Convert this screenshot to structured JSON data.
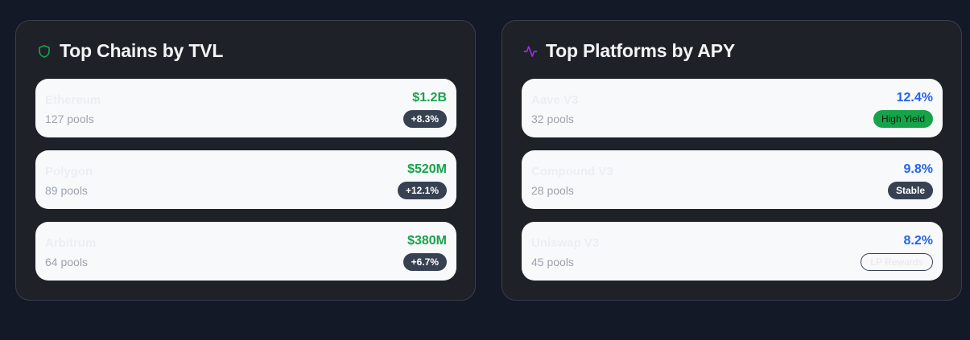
{
  "chains_panel": {
    "title": "Top Chains by TVL",
    "icon": "shield-icon",
    "rows": [
      {
        "name": "Ethereum",
        "pools": "127 pools",
        "value": "$1.2B",
        "change": "+8.3%"
      },
      {
        "name": "Polygon",
        "pools": "89 pools",
        "value": "$520M",
        "change": "+12.1%"
      },
      {
        "name": "Arbitrum",
        "pools": "64 pools",
        "value": "$380M",
        "change": "+6.7%"
      }
    ]
  },
  "platforms_panel": {
    "title": "Top Platforms by APY",
    "icon": "activity-icon",
    "rows": [
      {
        "name": "Aave V3",
        "pools": "32 pools",
        "value": "12.4%",
        "badge": "High Yield"
      },
      {
        "name": "Compound V3",
        "pools": "28 pools",
        "value": "9.8%",
        "badge": "Stable"
      },
      {
        "name": "Uniswap V3",
        "pools": "45 pools",
        "value": "8.2%",
        "badge": "LP Rewards"
      }
    ]
  },
  "colors": {
    "background": "#131927",
    "panel": "#1f2128",
    "green": "#16a34a",
    "blue": "#2563eb",
    "purple": "#9333ea"
  }
}
